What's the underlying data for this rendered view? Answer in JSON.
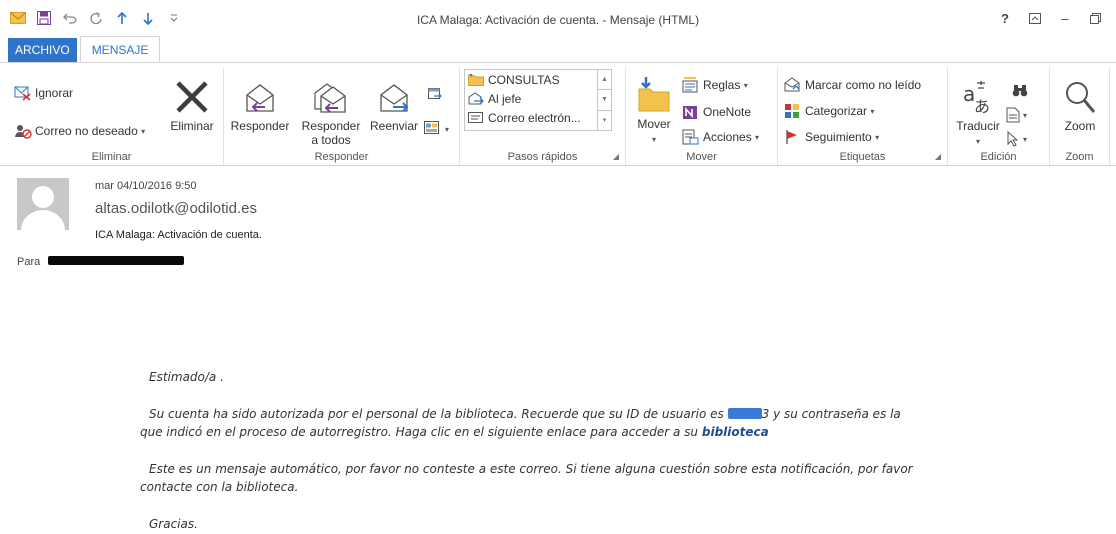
{
  "window": {
    "title": "ICA Malaga: Activación de cuenta. - Mensaje (HTML)",
    "help": "?",
    "restore_ribbon": "↗",
    "minimize": "–",
    "maximize": "□"
  },
  "tabs": {
    "file": "ARCHIVO",
    "message": "MENSAJE"
  },
  "ribbon": {
    "delete_group": {
      "label": "Eliminar",
      "ignore": "Ignorar",
      "junk": "Correo no deseado",
      "delete": "Eliminar"
    },
    "respond_group": {
      "label": "Responder",
      "reply": "Responder",
      "reply_all_1": "Responder",
      "reply_all_2": "a todos",
      "forward": "Reenviar"
    },
    "quicksteps_group": {
      "label": "Pasos rápidos",
      "items": [
        "CONSULTAS",
        "Al jefe",
        "Correo electrón..."
      ]
    },
    "move_group": {
      "label": "Mover",
      "move": "Mover",
      "rules": "Reglas",
      "onenote": "OneNote",
      "actions": "Acciones"
    },
    "tags_group": {
      "label": "Etiquetas",
      "mark_unread": "Marcar como no leído",
      "categorize": "Categorizar",
      "followup": "Seguimiento"
    },
    "editing_group": {
      "label": "Edición",
      "translate": "Traducir"
    },
    "zoom_group": {
      "label": "Zoom",
      "zoom": "Zoom"
    }
  },
  "header": {
    "date": "mar 04/10/2016 9:50",
    "from": "altas.odilotk@odilotid.es",
    "subject": "ICA Malaga: Activación de cuenta.",
    "to_label": "Para"
  },
  "body": {
    "greeting": "Estimado/a .",
    "p1_a": "Su cuenta ha sido autorizada por el personal de la biblioteca. Recuerde que su ID de usuario es",
    "p1_b": "3 y su contraseña es la",
    "p1_c": "que indicó en el proceso de autorregistro. Haga clic en el siguiente enlace para acceder a su",
    "p1_link": "biblioteca",
    "p2_a": "Este es un mensaje automático, por favor no conteste a este correo. Si tiene alguna cuestión sobre esta notificación, por favor",
    "p2_b": "contacte con la biblioteca.",
    "thanks": "Gracias."
  },
  "colors": {
    "accent": "#2f74c9",
    "link": "#1f4e8c",
    "redaction": "#3b7ad9"
  }
}
